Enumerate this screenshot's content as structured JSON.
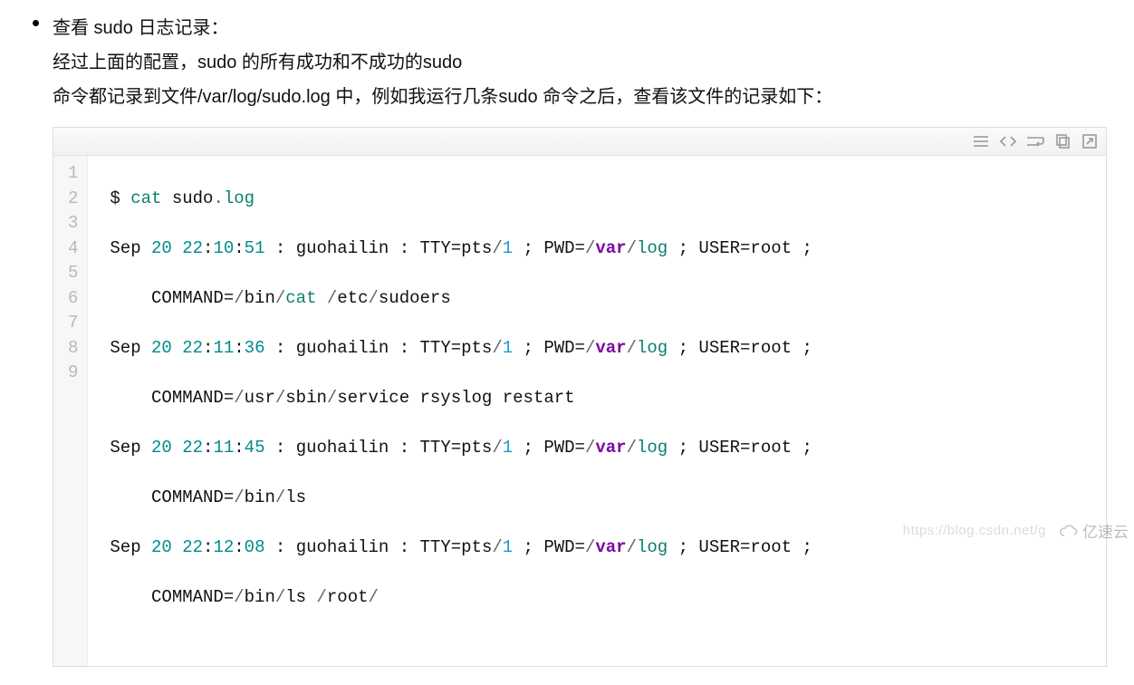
{
  "bullet": {
    "line1": "查看 sudo 日志记录：",
    "line2": "经过上面的配置，sudo 的所有成功和不成功的sudo",
    "line3": "命令都记录到文件/var/log/sudo.log 中，例如我运行几条sudo 命令之后，查看该文件的记录如下："
  },
  "toolbar": {
    "view_plain": "view plain",
    "view_source": "view source",
    "toggle_wrap": "toggle wrap",
    "copy": "copy",
    "popout": "open in new window"
  },
  "gutter": [
    "1",
    "2",
    "3",
    "4",
    "5",
    "6",
    "7",
    "8",
    "9"
  ],
  "code": {
    "l1": {
      "prompt": "$ ",
      "cmd": "cat",
      "sp": " sudo",
      "dot": ".",
      "ext": "log"
    },
    "entries": [
      {
        "head": {
          "mon": "Sep ",
          "day": "20",
          "sp1": " ",
          "h": "22",
          "c1": ":",
          "m": "10",
          "c2": ":",
          "s": "51",
          "rest": " : guohailin : TTY=pts",
          "slash": "/",
          "idx": "1",
          "sep": " ; PWD=",
          "pslash": "/",
          "p1": "var",
          "pslash2": "/",
          "p2": "log",
          "sep2": " ; USER=root ;"
        },
        "cmd": {
          "label": "COMMAND=",
          "s1": "/",
          "d1": "bin",
          "s2": "/",
          "d2": "cat ",
          "s3": "/",
          "d3": "etc",
          "s4": "/",
          "d4": "sudoers"
        }
      },
      {
        "head": {
          "mon": "Sep ",
          "day": "20",
          "sp1": " ",
          "h": "22",
          "c1": ":",
          "m": "11",
          "c2": ":",
          "s": "36",
          "rest": " : guohailin : TTY=pts",
          "slash": "/",
          "idx": "1",
          "sep": " ; PWD=",
          "pslash": "/",
          "p1": "var",
          "pslash2": "/",
          "p2": "log",
          "sep2": " ; USER=root ;"
        },
        "cmd": {
          "label": "COMMAND=",
          "s1": "/",
          "d1": "usr",
          "s2": "/",
          "d2": "sbin",
          "s3": "/",
          "d3": "service rsyslog restart",
          "s4": "",
          "d4": ""
        }
      },
      {
        "head": {
          "mon": "Sep ",
          "day": "20",
          "sp1": " ",
          "h": "22",
          "c1": ":",
          "m": "11",
          "c2": ":",
          "s": "45",
          "rest": " : guohailin : TTY=pts",
          "slash": "/",
          "idx": "1",
          "sep": " ; PWD=",
          "pslash": "/",
          "p1": "var",
          "pslash2": "/",
          "p2": "log",
          "sep2": " ; USER=root ;"
        },
        "cmd": {
          "label": "COMMAND=",
          "s1": "/",
          "d1": "bin",
          "s2": "/",
          "d2": "ls",
          "s3": "",
          "d3": "",
          "s4": "",
          "d4": ""
        }
      },
      {
        "head": {
          "mon": "Sep ",
          "day": "20",
          "sp1": " ",
          "h": "22",
          "c1": ":",
          "m": "12",
          "c2": ":",
          "s": "08",
          "rest": " : guohailin : TTY=pts",
          "slash": "/",
          "idx": "1",
          "sep": " ; PWD=",
          "pslash": "/",
          "p1": "var",
          "pslash2": "/",
          "p2": "log",
          "sep2": " ; USER=root ;"
        },
        "cmd": {
          "label": "COMMAND=",
          "s1": "/",
          "d1": "bin",
          "s2": "/",
          "d2": "ls ",
          "s3": "/",
          "d3": "root",
          "s4": "/",
          "d4": ""
        }
      }
    ]
  },
  "watermark": {
    "url": "https://blog.csdn.net/g",
    "brand": "亿速云"
  }
}
